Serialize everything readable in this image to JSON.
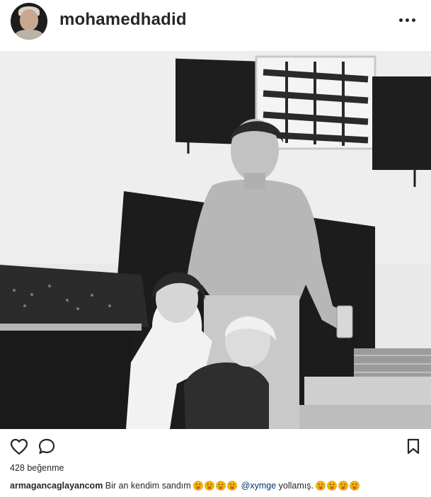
{
  "post": {
    "author": "mohamedhadid",
    "likes_text": "428 beğenme"
  },
  "caption": {
    "user": "armagancaglayancom",
    "text_before": "Bir an kendim sandım",
    "emoji_before": [
      "tongue-face",
      "tongue-face",
      "tongue-face",
      "tongue-face"
    ],
    "mention": "@xymge",
    "text_after": "yollamış.",
    "emoji_after": [
      "tongue-face",
      "tongue-face",
      "tongue-face",
      "tongue-face"
    ]
  },
  "icons": {
    "more": "more-options-icon",
    "like": "heart-icon",
    "comment": "comment-icon",
    "save": "bookmark-icon"
  }
}
